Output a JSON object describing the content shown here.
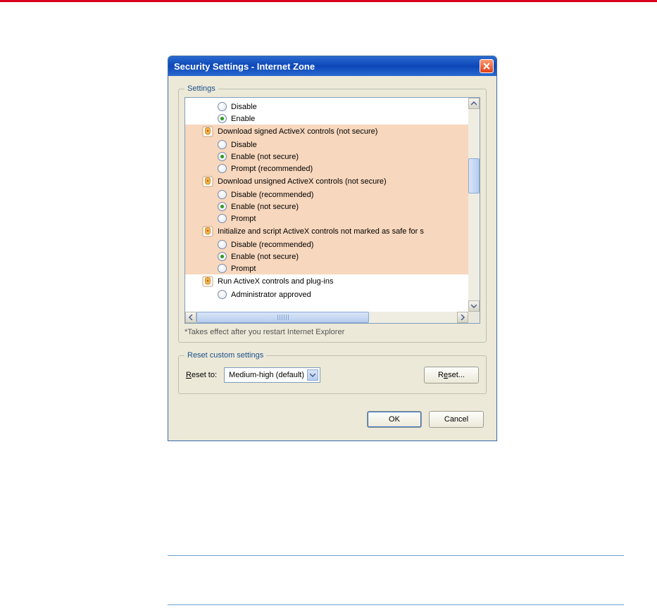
{
  "dialog": {
    "title": "Security Settings - Internet Zone"
  },
  "settings_group": {
    "legend": "Settings",
    "footnote": "*Takes effect after you restart Internet Explorer",
    "items": [
      {
        "type": "radio",
        "label": "Disable",
        "checked": false,
        "hl": false
      },
      {
        "type": "radio",
        "label": "Enable",
        "checked": true,
        "hl": false
      },
      {
        "type": "category",
        "label": "Download signed ActiveX controls (not secure)",
        "hl": true
      },
      {
        "type": "radio",
        "label": "Disable",
        "checked": false,
        "hl": true
      },
      {
        "type": "radio",
        "label": "Enable (not secure)",
        "checked": true,
        "hl": true
      },
      {
        "type": "radio",
        "label": "Prompt (recommended)",
        "checked": false,
        "hl": true
      },
      {
        "type": "category",
        "label": "Download unsigned ActiveX controls (not secure)",
        "hl": true
      },
      {
        "type": "radio",
        "label": "Disable (recommended)",
        "checked": false,
        "hl": true
      },
      {
        "type": "radio",
        "label": "Enable (not secure)",
        "checked": true,
        "hl": true
      },
      {
        "type": "radio",
        "label": "Prompt",
        "checked": false,
        "hl": true
      },
      {
        "type": "category",
        "label": "Initialize and script ActiveX controls not marked as safe for s",
        "hl": true
      },
      {
        "type": "radio",
        "label": "Disable (recommended)",
        "checked": false,
        "hl": true
      },
      {
        "type": "radio",
        "label": "Enable (not secure)",
        "checked": true,
        "hl": true
      },
      {
        "type": "radio",
        "label": "Prompt",
        "checked": false,
        "hl": true
      },
      {
        "type": "category",
        "label": "Run ActiveX controls and plug-ins",
        "hl": false
      },
      {
        "type": "radio",
        "label": "Administrator approved",
        "checked": false,
        "hl": false
      }
    ]
  },
  "reset_group": {
    "legend": "Reset custom settings",
    "label_prefix": "R",
    "label_rest": "eset to:",
    "select_value": "Medium-high (default)",
    "button_prefix": "R",
    "button_underline": "e",
    "button_rest": "set..."
  },
  "buttons": {
    "ok": "OK",
    "cancel": "Cancel"
  }
}
